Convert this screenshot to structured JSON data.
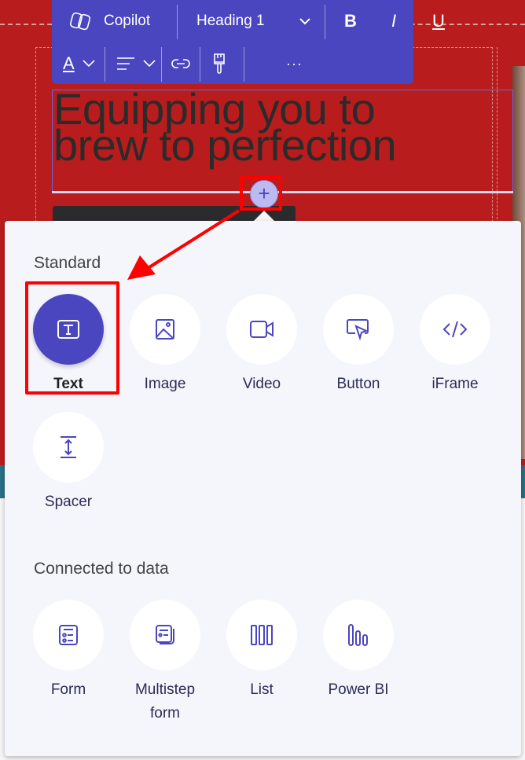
{
  "toolbar": {
    "copilot_label": "Copilot",
    "style_select": "Heading 1",
    "bold": "B",
    "italic": "I",
    "underline": "U",
    "font_color": "A",
    "more": "···"
  },
  "canvas": {
    "heading_line1": "Equipping you to",
    "heading_line2": "brew to perfection",
    "add_symbol": "+"
  },
  "panel": {
    "standard_title": "Standard",
    "standard_items": [
      {
        "label": "Text",
        "icon": "text-icon"
      },
      {
        "label": "Image",
        "icon": "image-icon"
      },
      {
        "label": "Video",
        "icon": "video-icon"
      },
      {
        "label": "Button",
        "icon": "button-icon"
      },
      {
        "label": "iFrame",
        "icon": "code-icon"
      },
      {
        "label": "Spacer",
        "icon": "spacer-icon"
      }
    ],
    "data_title": "Connected to data",
    "data_items": [
      {
        "label": "Form",
        "icon": "form-icon"
      },
      {
        "label": "Multistep form",
        "icon": "multistep-form-icon"
      },
      {
        "label": "List",
        "icon": "list-icon"
      },
      {
        "label": "Power BI",
        "icon": "power-bi-icon"
      }
    ]
  },
  "colors": {
    "accent": "#4a46c0",
    "highlight": "#ff0000",
    "hero": "#b91c1c"
  }
}
